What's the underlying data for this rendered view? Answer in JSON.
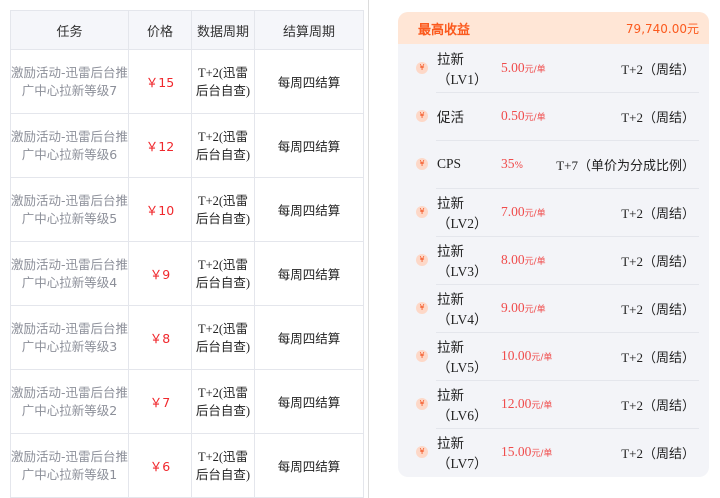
{
  "table": {
    "headers": {
      "task": "任务",
      "price": "价格",
      "data_period": "数据周期",
      "settle_period": "结算周期"
    },
    "rows": [
      {
        "name": "激励活动-迅雷后台推广中心拉新等级7",
        "price": "￥15",
        "period": "T+2(迅雷后台自查)",
        "settle": "每周四结算"
      },
      {
        "name": "激励活动-迅雷后台推广中心拉新等级6",
        "price": "￥12",
        "period": "T+2(迅雷后台自查)",
        "settle": "每周四结算"
      },
      {
        "name": "激励活动-迅雷后台推广中心拉新等级5",
        "price": "￥10",
        "period": "T+2(迅雷后台自查)",
        "settle": "每周四结算"
      },
      {
        "name": "激励活动-迅雷后台推广中心拉新等级4",
        "price": "￥9",
        "period": "T+2(迅雷后台自查)",
        "settle": "每周四结算"
      },
      {
        "name": "激励活动-迅雷后台推广中心拉新等级3",
        "price": "￥8",
        "period": "T+2(迅雷后台自查)",
        "settle": "每周四结算"
      },
      {
        "name": "激励活动-迅雷后台推广中心拉新等级2",
        "price": "￥7",
        "period": "T+2(迅雷后台自查)",
        "settle": "每周四结算"
      },
      {
        "name": "激励活动-迅雷后台推广中心拉新等级1",
        "price": "￥6",
        "period": "T+2(迅雷后台自查)",
        "settle": "每周四结算"
      }
    ]
  },
  "panel": {
    "title": "最高收益",
    "max_value": "79,740.00元",
    "row_icon": "yen-badge-icon",
    "rows": [
      {
        "name": "拉新（LV1）",
        "price": "5.00",
        "unit": "元/单",
        "settle": "T+2（周结）"
      },
      {
        "name": "促活",
        "price": "0.50",
        "unit": "元/单",
        "settle": "T+2（周结）"
      },
      {
        "name": "CPS",
        "price": "35",
        "unit": "%",
        "settle": "T+7（单价为分成比例）"
      },
      {
        "name": "拉新（LV2）",
        "price": "7.00",
        "unit": "元/单",
        "settle": "T+2（周结）"
      },
      {
        "name": "拉新（LV3）",
        "price": "8.00",
        "unit": "元/单",
        "settle": "T+2（周结）"
      },
      {
        "name": "拉新（LV4）",
        "price": "9.00",
        "unit": "元/单",
        "settle": "T+2（周结）"
      },
      {
        "name": "拉新（LV5）",
        "price": "10.00",
        "unit": "元/单",
        "settle": "T+2（周结）"
      },
      {
        "name": "拉新（LV6）",
        "price": "12.00",
        "unit": "元/单",
        "settle": "T+2（周结）"
      },
      {
        "name": "拉新（LV7）",
        "price": "15.00",
        "unit": "元/单",
        "settle": "T+2（周结）"
      }
    ]
  },
  "colors": {
    "price_red": "#f0282d",
    "accent_orange": "#fb5a1e",
    "panel_bg": "#f3f4f8",
    "header_bg": "#ffe6d6"
  }
}
